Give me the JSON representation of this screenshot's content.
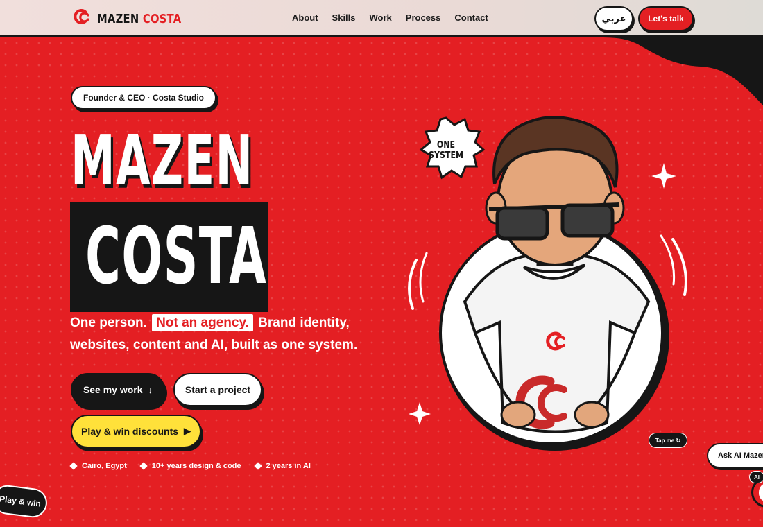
{
  "brand": {
    "first": "MAZEN",
    "second": "COSTA",
    "logo_icon": "cc-loop-icon",
    "accent_color": "#e41f23",
    "dark_color": "#161616"
  },
  "nav": {
    "links": [
      "About",
      "Skills",
      "Work",
      "Process",
      "Contact"
    ],
    "lang_button": "عربي",
    "cta_button": "Let's talk"
  },
  "hero": {
    "badge": "Founder & CEO · Costa Studio",
    "name_first": "MAZEN",
    "name_second": "COSTA",
    "tagline_before": "One person.",
    "tagline_highlight": "Not an agency.",
    "tagline_after": "Brand identity, websites, content and AI, built as one system.",
    "buttons": {
      "work": "See my work",
      "work_icon": "↓",
      "project": "Start a project",
      "play": "Play & win discounts",
      "play_icon": "▶"
    },
    "meta": [
      "Cairo, Egypt",
      "10+ years design & code",
      "2 years in AI"
    ]
  },
  "illustration": {
    "sticker": "ONE SYSTEM",
    "tap_label": "Tap me ↻"
  },
  "floating": {
    "play_label": "Play & win",
    "ask_label": "Ask AI Mazen",
    "ai_badge": "AI"
  }
}
